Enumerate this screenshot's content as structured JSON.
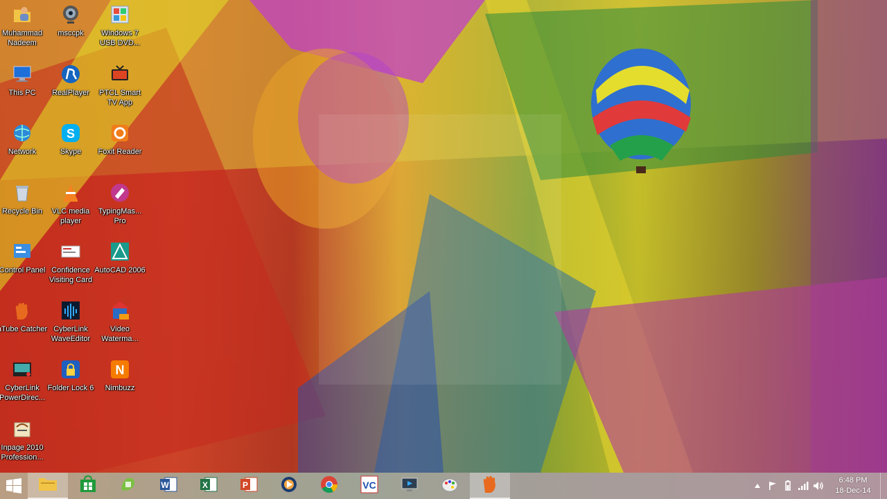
{
  "desktop": {
    "icons": [
      {
        "label": "Muhammad Nadeem",
        "icon": "user-folder-icon"
      },
      {
        "label": "msccpk",
        "icon": "webcam-icon"
      },
      {
        "label": "Windows 7 USB DVD...",
        "icon": "usb-dvd-tool-icon"
      },
      {
        "label": "This PC",
        "icon": "computer-icon"
      },
      {
        "label": "RealPlayer",
        "icon": "realplayer-icon"
      },
      {
        "label": "PTCL Smart TV App",
        "icon": "tv-app-icon"
      },
      {
        "label": "Network",
        "icon": "network-icon"
      },
      {
        "label": "Skype",
        "icon": "skype-icon"
      },
      {
        "label": "Foxit Reader",
        "icon": "foxit-reader-icon"
      },
      {
        "label": "Recycle Bin",
        "icon": "recycle-bin-icon"
      },
      {
        "label": "VLC media player",
        "icon": "vlc-icon"
      },
      {
        "label": "TypingMas... Pro",
        "icon": "typing-master-icon"
      },
      {
        "label": "Control Panel",
        "icon": "control-panel-icon"
      },
      {
        "label": "Confidence Visiting Card",
        "icon": "visiting-card-icon"
      },
      {
        "label": "AutoCAD 2006",
        "icon": "autocad-icon"
      },
      {
        "label": "aTube Catcher",
        "icon": "atube-catcher-icon"
      },
      {
        "label": "CyberLink WaveEditor",
        "icon": "wave-editor-icon"
      },
      {
        "label": "Video Waterma...",
        "icon": "video-watermark-icon"
      },
      {
        "label": "CyberLink PowerDirec...",
        "icon": "power-director-icon"
      },
      {
        "label": "Folder Lock 6",
        "icon": "folder-lock-icon"
      },
      {
        "label": "Nimbuzz",
        "icon": "nimbuzz-icon"
      },
      {
        "label": "Inpage 2010 Profession...",
        "icon": "inpage-icon"
      }
    ]
  },
  "taskbar": {
    "start_icon": "windows-logo-icon",
    "pinned": [
      {
        "icon": "file-explorer-icon",
        "active": true
      },
      {
        "icon": "store-icon",
        "active": false
      },
      {
        "icon": "camtasia-icon",
        "active": false
      },
      {
        "icon": "word-icon",
        "active": false
      },
      {
        "icon": "excel-icon",
        "active": false
      },
      {
        "icon": "powerpoint-icon",
        "active": false
      },
      {
        "icon": "media-player-icon",
        "active": false
      },
      {
        "icon": "chrome-icon",
        "active": false
      },
      {
        "icon": "vc-icon",
        "active": false
      },
      {
        "icon": "screen-recorder-icon",
        "active": false
      },
      {
        "icon": "paint-icon",
        "active": false
      },
      {
        "icon": "atube-catcher-icon",
        "active": true
      }
    ],
    "tray": {
      "icons": [
        "show-hidden-icons-icon",
        "action-center-flag-icon",
        "power-icon",
        "network-signal-icon",
        "volume-icon"
      ],
      "time": "6:48 PM",
      "date": "18-Dec-14"
    }
  }
}
